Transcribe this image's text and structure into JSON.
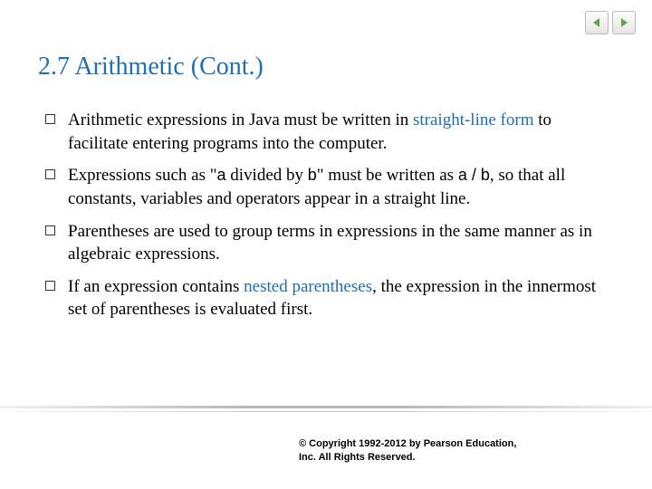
{
  "title": "2.7  Arithmetic (Cont.)",
  "bullets": [
    {
      "pre": "Arithmetic expressions in Java must be written in ",
      "hl": "straight-line form",
      "post": " to facilitate entering programs into the computer."
    },
    {
      "text_parts": [
        "Expressions such as \"",
        "a",
        " divided by ",
        "b",
        "\" must be written as ",
        "a / b",
        ", so that all constants, variables and operators appear in a straight line."
      ]
    },
    {
      "plain": "Parentheses are used to group terms in expressions in the same manner as in algebraic expressions."
    },
    {
      "pre": "If an expression contains ",
      "hl": "nested parentheses",
      "post": ", the expression in the innermost set of parentheses is evaluated first."
    }
  ],
  "copyright": "© Copyright 1992-2012 by Pearson Education, Inc. All Rights Reserved."
}
